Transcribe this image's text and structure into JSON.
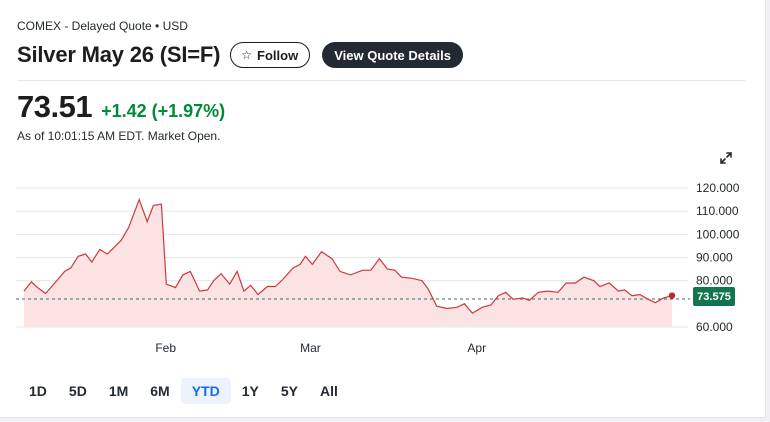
{
  "header": {
    "exchange": "COMEX - Delayed Quote • USD",
    "title": "Silver May 26 (SI=F)",
    "follow_label": "Follow",
    "details_label": "View Quote Details"
  },
  "quote": {
    "price": "73.51",
    "change": "+1.42 (+1.97%)",
    "as_of": "As of 10:01:15 AM EDT. Market Open.",
    "change_color": "#008a3a"
  },
  "ranges": [
    {
      "label": "1D",
      "active": false
    },
    {
      "label": "5D",
      "active": false
    },
    {
      "label": "1M",
      "active": false
    },
    {
      "label": "6M",
      "active": false
    },
    {
      "label": "YTD",
      "active": true
    },
    {
      "label": "1Y",
      "active": false
    },
    {
      "label": "5Y",
      "active": false
    },
    {
      "label": "All",
      "active": false
    }
  ],
  "icons": {
    "follow": "star-icon",
    "expand": "expand-icon"
  },
  "chart_data": {
    "type": "area",
    "x_range": [
      0,
      100
    ],
    "ylim": [
      60,
      120
    ],
    "y_ticks": [
      {
        "value": 120,
        "label": "120.000"
      },
      {
        "value": 110,
        "label": "110.000"
      },
      {
        "value": 100,
        "label": "100.000"
      },
      {
        "value": 90,
        "label": "90.000"
      },
      {
        "value": 80,
        "label": "80.000"
      },
      {
        "value": 60,
        "label": "60.000"
      }
    ],
    "x_ticks": [
      {
        "x": 23,
        "label": "Feb"
      },
      {
        "x": 46.5,
        "label": "Mar"
      },
      {
        "x": 73.5,
        "label": "Apr"
      }
    ],
    "grid": true,
    "reference_line": 72.09,
    "current": {
      "value": 73.575,
      "label": "73.575"
    },
    "line_color": "#d0373e",
    "fill_color": "#fbe3e4",
    "tag_color": "#13754f",
    "points": [
      [
        0,
        75.5
      ],
      [
        1.2,
        79.5
      ],
      [
        2.2,
        77
      ],
      [
        3.5,
        74.5
      ],
      [
        5,
        79
      ],
      [
        6.6,
        84
      ],
      [
        7.6,
        85.5
      ],
      [
        8.8,
        90.5
      ],
      [
        10,
        91.5
      ],
      [
        11,
        88
      ],
      [
        12.3,
        93.5
      ],
      [
        13.5,
        91.5
      ],
      [
        14.5,
        94
      ],
      [
        15.8,
        97.5
      ],
      [
        17,
        103
      ],
      [
        18.7,
        115
      ],
      [
        20,
        105.5
      ],
      [
        21,
        112.5
      ],
      [
        22.3,
        113
      ],
      [
        23.1,
        78.5
      ],
      [
        24.6,
        77
      ],
      [
        25.8,
        82.5
      ],
      [
        27,
        84
      ],
      [
        28.5,
        75.5
      ],
      [
        29.8,
        76
      ],
      [
        30.8,
        80
      ],
      [
        32,
        83
      ],
      [
        33.4,
        78.5
      ],
      [
        34.6,
        84
      ],
      [
        35.7,
        75.5
      ],
      [
        36.8,
        78
      ],
      [
        38,
        74
      ],
      [
        39.5,
        77.5
      ],
      [
        40.8,
        77.5
      ],
      [
        42,
        80.5
      ],
      [
        43.7,
        85.5
      ],
      [
        44.8,
        87
      ],
      [
        45.7,
        90.5
      ],
      [
        46.8,
        87
      ],
      [
        48.3,
        92.5
      ],
      [
        50,
        89.5
      ],
      [
        51.3,
        84
      ],
      [
        53,
        82.5
      ],
      [
        55,
        84.5
      ],
      [
        56.3,
        84.5
      ],
      [
        57.7,
        89.5
      ],
      [
        59,
        85
      ],
      [
        60.2,
        84.5
      ],
      [
        61.3,
        81.5
      ],
      [
        63,
        81
      ],
      [
        64.6,
        80
      ],
      [
        65.6,
        76.5
      ],
      [
        67,
        69
      ],
      [
        68.7,
        68
      ],
      [
        70.3,
        68.5
      ],
      [
        71.5,
        70
      ],
      [
        72.8,
        66
      ],
      [
        74.4,
        68.5
      ],
      [
        75.8,
        69.5
      ],
      [
        77,
        73.5
      ],
      [
        78.2,
        75
      ],
      [
        79.4,
        72
      ],
      [
        81,
        72.5
      ],
      [
        82,
        71.5
      ],
      [
        83.5,
        75
      ],
      [
        85,
        75.5
      ],
      [
        86.7,
        75
      ],
      [
        88,
        79
      ],
      [
        89.5,
        79
      ],
      [
        90.9,
        81.5
      ],
      [
        92.5,
        80
      ],
      [
        93.5,
        77.5
      ],
      [
        95,
        79
      ],
      [
        96.5,
        75.5
      ],
      [
        97.5,
        76
      ],
      [
        98.7,
        73.5
      ],
      [
        100,
        74
      ],
      [
        101.3,
        72
      ],
      [
        102.5,
        70.5
      ],
      [
        103.8,
        72.5
      ],
      [
        105.2,
        73.575
      ]
    ]
  }
}
